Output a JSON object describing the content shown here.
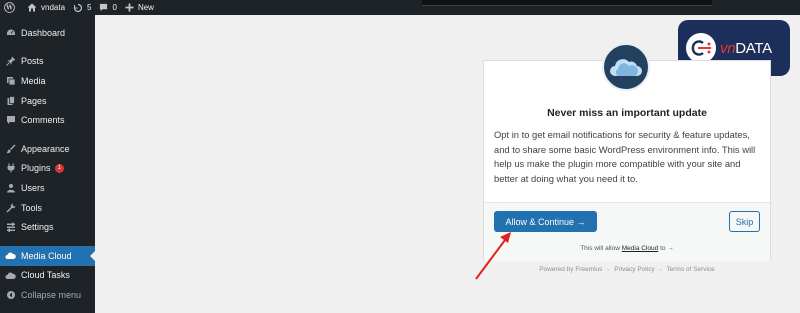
{
  "adminbar": {
    "site_name": "vndata",
    "updates_count": "5",
    "comments_count": "0",
    "new_label": "New"
  },
  "sidebar": {
    "items": [
      {
        "label": "Dashboard",
        "icon": "dashboard-icon"
      },
      {
        "label": "Posts",
        "icon": "pin-icon"
      },
      {
        "label": "Media",
        "icon": "media-icon"
      },
      {
        "label": "Pages",
        "icon": "pages-icon"
      },
      {
        "label": "Comments",
        "icon": "comments-icon"
      },
      {
        "label": "Appearance",
        "icon": "brush-icon"
      },
      {
        "label": "Plugins",
        "icon": "plugin-icon",
        "badge": "1"
      },
      {
        "label": "Users",
        "icon": "users-icon"
      },
      {
        "label": "Tools",
        "icon": "wrench-icon"
      },
      {
        "label": "Settings",
        "icon": "settings-icon"
      },
      {
        "label": "Media Cloud",
        "icon": "cloud-icon",
        "active": true
      },
      {
        "label": "Cloud Tasks",
        "icon": "cloud-tasks-icon"
      },
      {
        "label": "Collapse menu",
        "icon": "collapse-icon"
      }
    ]
  },
  "logo": {
    "text_prefix": "vn",
    "text_suffix": "DATA"
  },
  "optin": {
    "title": "Never miss an important update",
    "message": "Opt in to get email notifications for security & feature updates, and to share some basic WordPress environment info. This will help us make the plugin more compatible with your site and better at doing what you need it to.",
    "allow_button": "Allow & Continue →",
    "skip_button": "Skip",
    "permissions_prefix": "This will allow",
    "permissions_link": "Media Cloud",
    "permissions_suffix": "to →"
  },
  "footer": {
    "powered_by": "Powered by Freemius",
    "separator": "-",
    "privacy": "Privacy Policy",
    "terms": "Terms of Service"
  },
  "colors": {
    "admin_dark": "#1d2327",
    "accent_blue": "#2271b1",
    "badge_red": "#d63638",
    "arrow_red": "#e0221a",
    "logo_navy": "#1c2f5a"
  }
}
